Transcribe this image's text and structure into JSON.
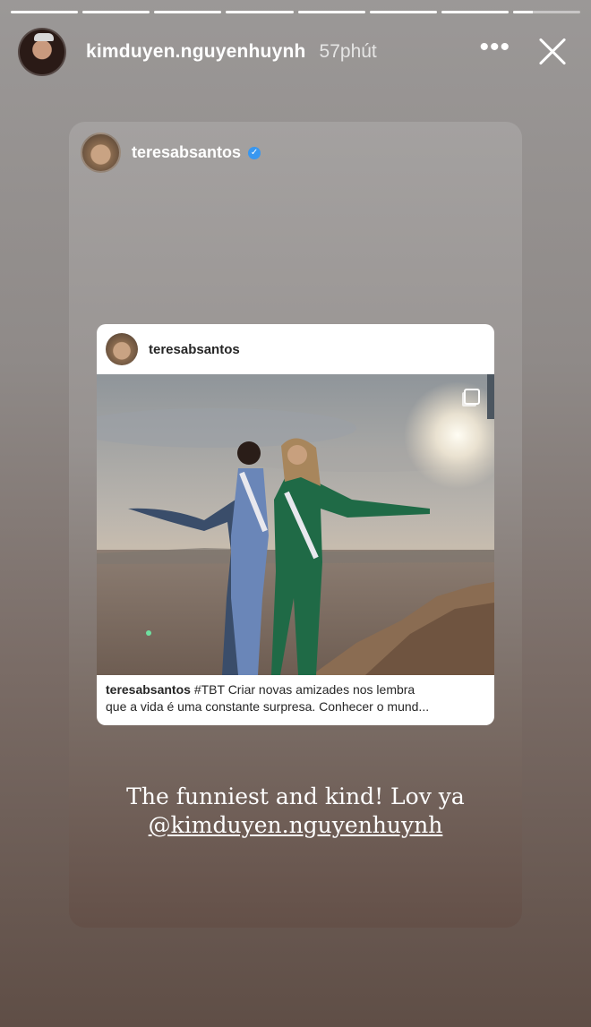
{
  "progress": [
    1,
    1,
    1,
    1,
    1,
    1,
    1,
    0.3
  ],
  "header": {
    "username": "kimduyen.nguyenhuynh",
    "time": "57phút",
    "more_icon": "more-dots-icon",
    "close_icon": "close-icon"
  },
  "shared": {
    "username": "teresabsantos",
    "verified_icon": "verified-badge-icon"
  },
  "post": {
    "username": "teresabsantos",
    "caption_user": "teresabsantos",
    "caption_line1": "#TBT Criar novas amizades nos lembra",
    "caption_line2": "que a vida é uma constante surpresa. Conhecer o mund...",
    "multi_photo_icon": "multiple-photos-icon"
  },
  "story_text": {
    "line1": "The funniest and kind! Lov ya",
    "mention": "@kimduyen.nguyenhuynh"
  }
}
